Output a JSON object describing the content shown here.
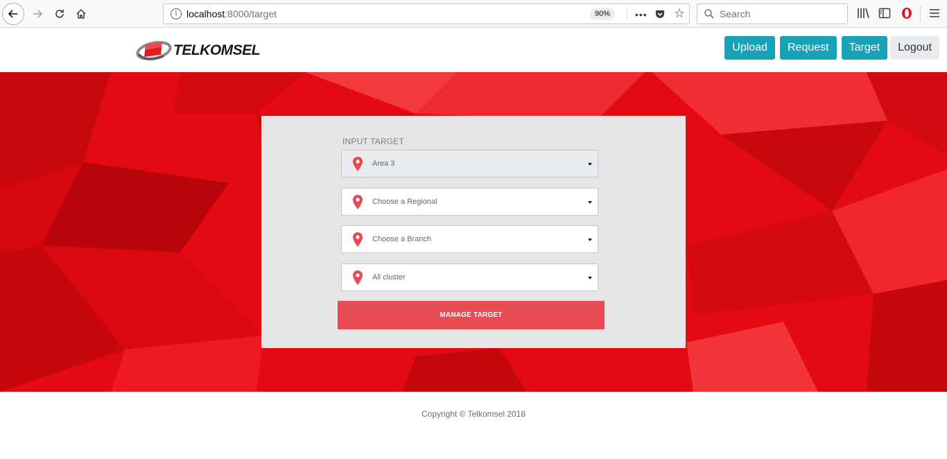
{
  "browser": {
    "url_host": "localhost",
    "url_path": ":8000/target",
    "zoom": "90%",
    "search_placeholder": "Search"
  },
  "header": {
    "logo_text": "TELKOMSEL",
    "nav": {
      "upload": "Upload",
      "request": "Request",
      "target": "Target",
      "logout": "Logout"
    },
    "nav_color": "#17a2b8"
  },
  "form": {
    "label": "INPUT TARGET",
    "area": "Area 3",
    "regional": "Choose a Regional",
    "branch": "Choose a Branch",
    "cluster": "All cluster",
    "submit": "MANAGE TARGET",
    "submit_color": "#ea4c56"
  },
  "footer": {
    "copyright": "Copyright © Telkomsel 2018"
  },
  "hero_color": "#e10a0f"
}
